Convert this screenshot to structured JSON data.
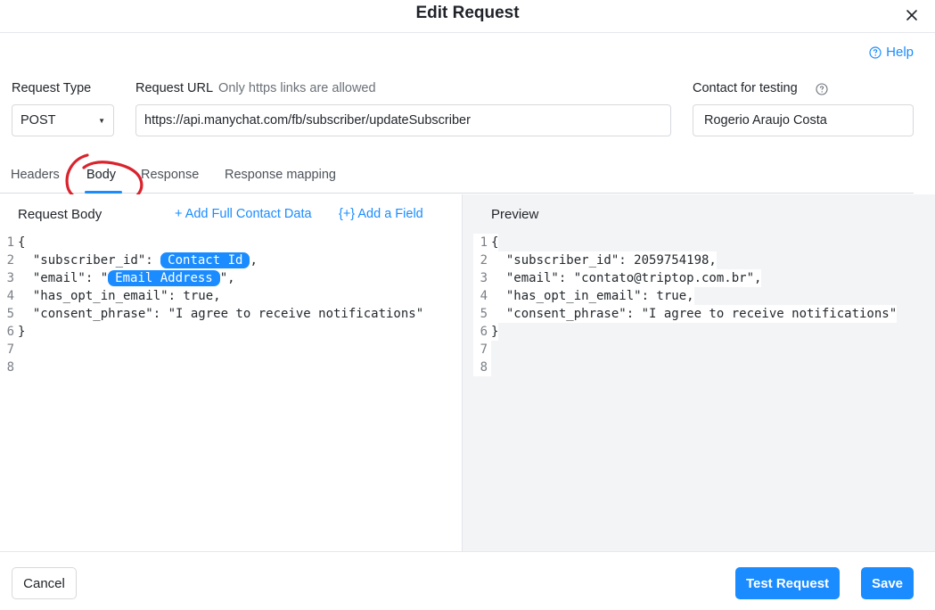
{
  "dialog": {
    "title": "Edit Request",
    "help_label": "Help"
  },
  "form": {
    "request_type_label": "Request Type",
    "request_type_value": "POST",
    "request_url_label": "Request URL",
    "request_url_hint": "Only https links are allowed",
    "request_url_value": "https://api.manychat.com/fb/subscriber/updateSubscriber",
    "contact_label": "Contact for testing",
    "contact_value": "Rogerio Araujo Costa"
  },
  "tabs": [
    {
      "label": "Headers",
      "active": false
    },
    {
      "label": "Body",
      "active": true
    },
    {
      "label": "Response",
      "active": false
    },
    {
      "label": "Response mapping",
      "active": false
    }
  ],
  "request_body": {
    "title": "Request Body",
    "add_full_contact": "+ Add Full Contact Data",
    "add_field": "{+} Add a Field",
    "lines": [
      {
        "n": "1",
        "text": "{"
      },
      {
        "n": "2",
        "pre": "  \"subscriber_id\": ",
        "chip": "Contact Id",
        "post": ","
      },
      {
        "n": "3",
        "pre": "  \"email\": \"",
        "chip": "Email Address",
        "post": "\","
      },
      {
        "n": "4",
        "text": "  \"has_opt_in_email\": true,"
      },
      {
        "n": "5",
        "text": "  \"consent_phrase\": \"I agree to receive notifications\""
      },
      {
        "n": "6",
        "text": "}"
      },
      {
        "n": "7",
        "text": ""
      },
      {
        "n": "8",
        "text": ""
      }
    ]
  },
  "preview": {
    "title": "Preview",
    "lines": [
      {
        "n": "1",
        "text": "{"
      },
      {
        "n": "2",
        "text": "  \"subscriber_id\": 2059754198,"
      },
      {
        "n": "3",
        "text": "  \"email\": \"contato@triptop.com.br\","
      },
      {
        "n": "4",
        "text": "  \"has_opt_in_email\": true,"
      },
      {
        "n": "5",
        "text": "  \"consent_phrase\": \"I agree to receive notifications\""
      },
      {
        "n": "6",
        "text": "}"
      },
      {
        "n": "7",
        "text": ""
      },
      {
        "n": "8",
        "text": ""
      }
    ]
  },
  "footer": {
    "cancel_label": "Cancel",
    "test_label": "Test Request",
    "save_label": "Save"
  },
  "colors": {
    "accent": "#1a8cff",
    "annotation": "#d9232d"
  }
}
